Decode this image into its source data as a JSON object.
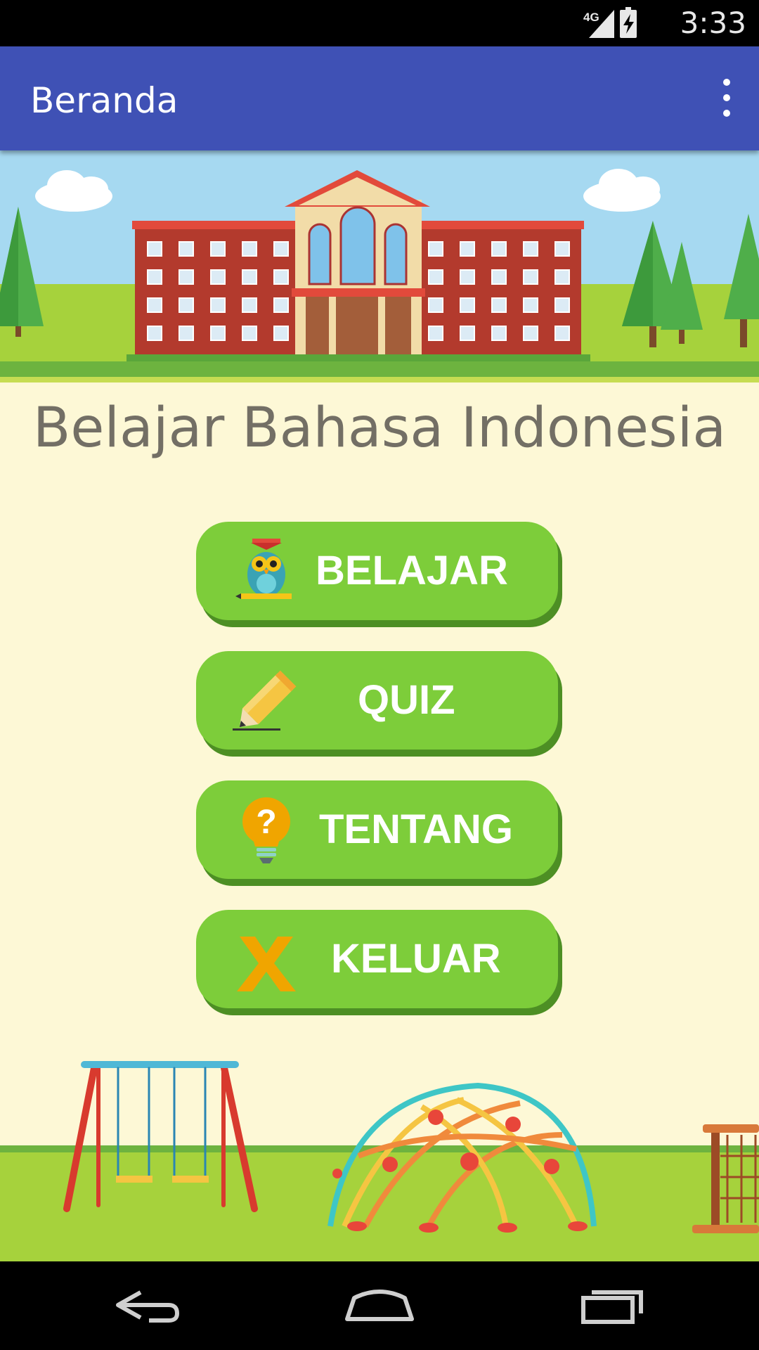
{
  "status_bar": {
    "time": "3:33",
    "network": "4G",
    "icons": [
      "signal-icon",
      "battery-charging-icon"
    ]
  },
  "app_bar": {
    "title": "Beranda",
    "menu_icon": "more-vert-icon"
  },
  "main": {
    "title": "Belajar Bahasa Indonesia",
    "buttons": [
      {
        "label": "BELAJAR",
        "icon": "owl-icon"
      },
      {
        "label": "QUIZ",
        "icon": "pencil-icon"
      },
      {
        "label": "TENTANG",
        "icon": "question-bulb-icon"
      },
      {
        "label": "KELUAR",
        "icon": "x-icon"
      }
    ]
  },
  "nav_bar": {
    "buttons": [
      "back-icon",
      "home-icon",
      "recents-icon"
    ]
  },
  "colors": {
    "app_bar": "#3f51b5",
    "background": "#fdf8d6",
    "button": "#7dcd3a",
    "button_shadow": "#4d8f24",
    "title_text": "#736f65"
  }
}
